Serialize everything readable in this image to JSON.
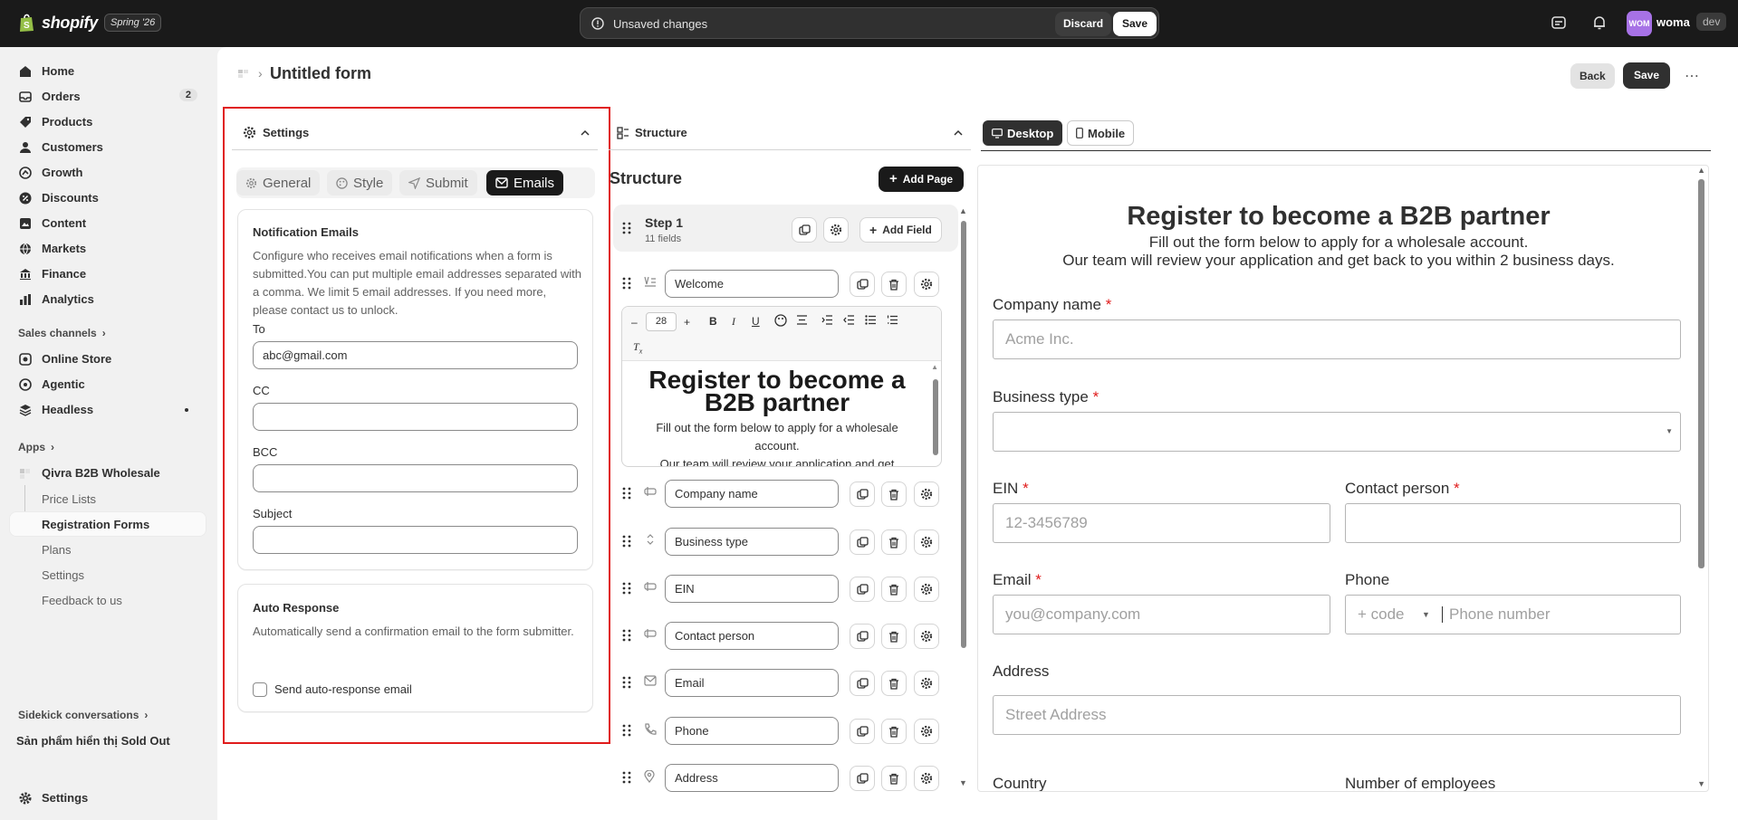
{
  "topbar": {
    "logo_text": "shopify",
    "edition": "Spring '26",
    "unsaved_text": "Unsaved changes",
    "discard_label": "Discard",
    "save_label": "Save",
    "avatar_initials": "WOM",
    "user_name": "woma",
    "store_badge": "dev"
  },
  "sidebar": {
    "items": [
      {
        "label": "Home",
        "icon": "home-icon"
      },
      {
        "label": "Orders",
        "icon": "orders-icon",
        "badge": "2"
      },
      {
        "label": "Products",
        "icon": "tag-icon"
      },
      {
        "label": "Customers",
        "icon": "person-icon"
      },
      {
        "label": "Growth",
        "icon": "growth-icon"
      },
      {
        "label": "Discounts",
        "icon": "discount-icon"
      },
      {
        "label": "Content",
        "icon": "content-icon"
      },
      {
        "label": "Markets",
        "icon": "globe-icon"
      },
      {
        "label": "Finance",
        "icon": "bank-icon"
      },
      {
        "label": "Analytics",
        "icon": "bar-chart-icon"
      }
    ],
    "sales_channels_label": "Sales channels",
    "channels": [
      {
        "label": "Online Store",
        "icon": "store-icon"
      },
      {
        "label": "Agentic",
        "icon": "agentic-icon"
      },
      {
        "label": "Headless",
        "icon": "headless-icon"
      }
    ],
    "apps_label": "Apps",
    "app_name": "Qivra B2B Wholesale",
    "app_subitems": [
      "Price Lists",
      "Registration Forms",
      "Plans",
      "Settings",
      "Feedback to us"
    ],
    "sidekick_label": "Sidekick conversations",
    "sidekick_item": "Sản phẩm hiển thị Sold Out",
    "settings_label": "Settings"
  },
  "header": {
    "title": "Untitled form",
    "back_label": "Back",
    "save_label": "Save",
    "more_label": "⋯"
  },
  "settings_panel": {
    "title": "Settings",
    "tabs": [
      "General",
      "Style",
      "Submit",
      "Emails"
    ],
    "active_tab": "Emails",
    "notification": {
      "title": "Notification Emails",
      "description": "Configure who receives email notifications when a form is submitted.You can put multiple email addresses separated with a comma. We limit 5 email addresses. If you need more, please contact us to unlock.",
      "to_label": "To",
      "to_value": "abc@gmail.com",
      "cc_label": "CC",
      "cc_value": "",
      "bcc_label": "BCC",
      "bcc_value": "",
      "subject_label": "Subject",
      "subject_value": ""
    },
    "auto_response": {
      "title": "Auto Response",
      "description": "Automatically send a confirmation email to the form submitter.",
      "checkbox_label": "Send auto-response email",
      "checked": false
    }
  },
  "structure_panel": {
    "header": "Structure",
    "title": "Structure",
    "add_page_label": "Add Page",
    "step_title": "Step 1",
    "step_count": "11 fields",
    "add_field_label": "Add Field",
    "editor": {
      "font_size": "28",
      "heading": "Register to become a B2B partner",
      "text_line1": "Fill out the form below to apply for a wholesale account.",
      "text_line2": "Our team will review your application and get"
    },
    "fields": [
      {
        "label": "Welcome",
        "icon": "text-block-icon"
      },
      {
        "label": "Company name",
        "icon": "text-field-icon"
      },
      {
        "label": "Business type",
        "icon": "select-icon"
      },
      {
        "label": "EIN",
        "icon": "text-field-icon"
      },
      {
        "label": "Contact person",
        "icon": "text-field-icon"
      },
      {
        "label": "Email",
        "icon": "email-icon"
      },
      {
        "label": "Phone",
        "icon": "phone-icon"
      },
      {
        "label": "Address",
        "icon": "location-icon"
      }
    ]
  },
  "preview": {
    "tabs": [
      "Desktop",
      "Mobile"
    ],
    "active_tab": "Desktop",
    "title": "Register to become a B2B partner",
    "subtitle1": "Fill out the form below to apply for a wholesale account.",
    "subtitle2": "Our team will review your application and get back to you within 2 business days.",
    "company_label": "Company name",
    "company_placeholder": "Acme Inc.",
    "business_label": "Business type",
    "ein_label": "EIN",
    "ein_placeholder": "12-3456789",
    "contact_label": "Contact person",
    "email_label": "Email",
    "email_placeholder": "you@company.com",
    "phone_label": "Phone",
    "phone_code": "+ code",
    "phone_placeholder": "Phone number",
    "address_label": "Address",
    "address_placeholder": "Street Address",
    "country_label": "Country",
    "employees_label": "Number of employees",
    "required_mark": "*"
  },
  "colors": {
    "topbar_bg": "#1a1a1a",
    "highlight_outline": "#e01b1b",
    "primary_button": "#1a1a1a",
    "avatar": "#a772e6"
  }
}
